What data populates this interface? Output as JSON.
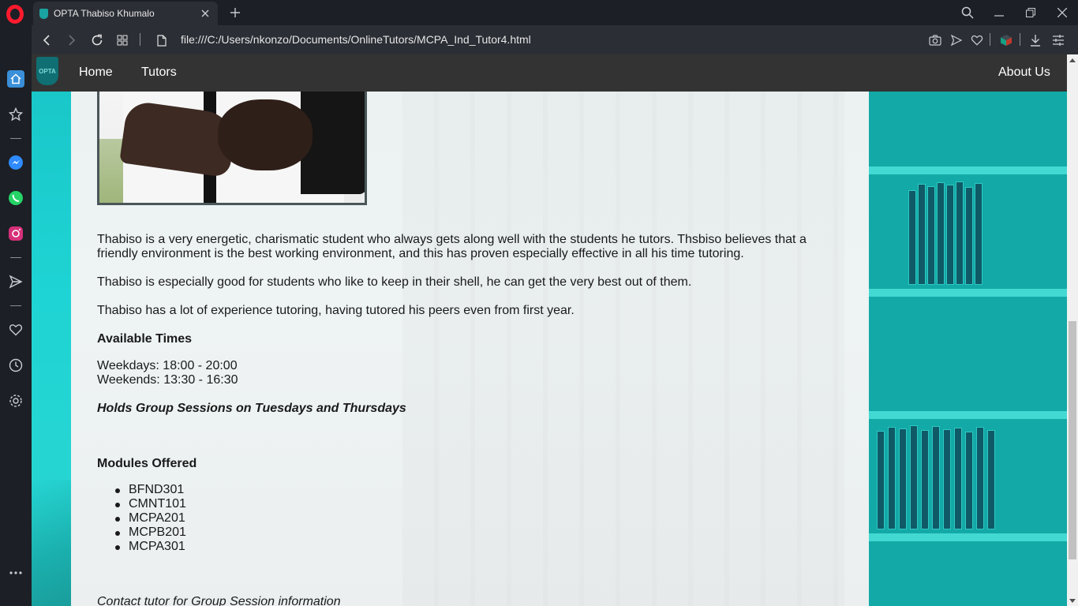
{
  "browser": {
    "tab_title": "OPTA Thabiso Khumalo",
    "url": "file:///C:/Users/nkonzo/Documents/OnlineTutors/MCPA_Ind_Tutor4.html",
    "accent_color": "#ff1b2d"
  },
  "sidebar_icons": [
    "home-icon",
    "star-icon",
    "messenger-icon",
    "whatsapp-icon",
    "instagram-icon",
    "send-icon",
    "heart-icon",
    "history-icon",
    "settings-icon",
    "more-icon"
  ],
  "site": {
    "logo_text": "OPTA",
    "nav": {
      "home": "Home",
      "tutors": "Tutors",
      "about": "About Us"
    }
  },
  "tutor": {
    "paragraph_1": "Thabiso is a very energetic, charismatic student who always gets along well with the students he tutors. Thsbiso believes that a friendly environment is the best working environment, and this has proven especially effective in all his time tutoring.",
    "paragraph_2": "Thabiso is especially good for students who like to keep in their shell, he can get the very best out of them.",
    "paragraph_3": "Thabiso has a lot of experience tutoring, having tutored his peers even from first year.",
    "available_times_heading": "Available Times",
    "weekdays": "Weekdays: 18:00 - 20:00",
    "weekends": "Weekends: 13:30 - 16:30",
    "group_sessions": "Holds Group Sessions on Tuesdays and Thursdays",
    "modules_heading": "Modules Offered",
    "modules": [
      "BFND301",
      "CMNT101",
      "MCPA201",
      "MCPB201",
      "MCPA301"
    ],
    "contact_note": "Contact tutor for Group Session information"
  },
  "colors": {
    "site_nav_bg": "#333333",
    "teal": "#19c7c9"
  }
}
